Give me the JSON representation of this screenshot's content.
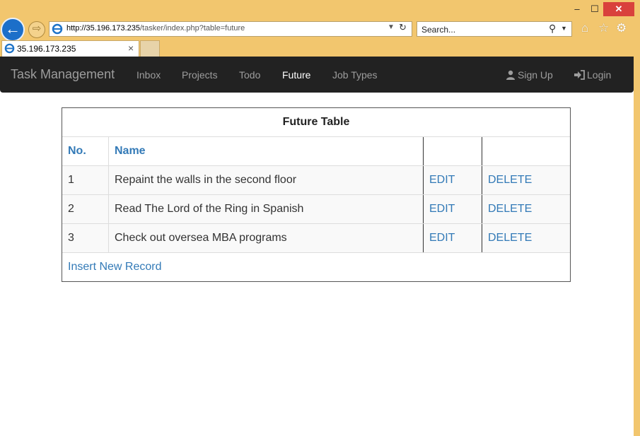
{
  "browser": {
    "address_host": "http://35.196.173.235",
    "address_path": "/tasker/index.php?table=future",
    "search_placeholder": "Search...",
    "tab_label": "35.196.173.235"
  },
  "navbar": {
    "brand": "Task Management",
    "links": [
      "Inbox",
      "Projects",
      "Todo",
      "Future",
      "Job Types"
    ],
    "active": "Future",
    "signup": "Sign Up",
    "login": "Login"
  },
  "table": {
    "caption": "Future Table",
    "headers": [
      "No.",
      "Name",
      "",
      ""
    ],
    "rows": [
      {
        "no": "1",
        "name": "Repaint the walls in the second floor",
        "edit": "EDIT",
        "delete": "DELETE"
      },
      {
        "no": "2",
        "name": "Read The Lord of the Ring in Spanish",
        "edit": "EDIT",
        "delete": "DELETE"
      },
      {
        "no": "3",
        "name": "Check out oversea MBA programs",
        "edit": "EDIT",
        "delete": "DELETE"
      }
    ],
    "insert_label": "Insert New Record"
  },
  "colors": {
    "link": "#337ab7",
    "navbar_bg": "#222222",
    "chrome_bg": "#f2c66e"
  }
}
